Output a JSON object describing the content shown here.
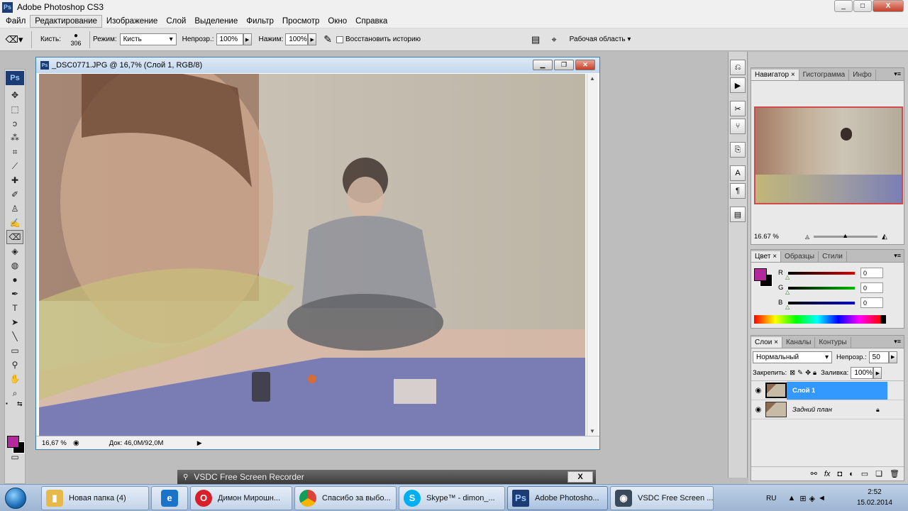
{
  "window": {
    "title": "Adobe Photoshop CS3",
    "min": "_",
    "max": "□",
    "close": "X"
  },
  "menu": [
    "Файл",
    "Редактирование",
    "Изображение",
    "Слой",
    "Выделение",
    "Фильтр",
    "Просмотр",
    "Окно",
    "Справка"
  ],
  "options": {
    "brush_label": "Кисть:",
    "brush_size": "306",
    "mode_label": "Режим:",
    "mode_value": "Кисть",
    "opacity_label": "Непрозр.:",
    "opacity_value": "100%",
    "flow_label": "Нажим:",
    "flow_value": "100%",
    "restore_history": "Восстановить историю",
    "workspace": "Рабочая область ▾"
  },
  "document": {
    "title": "_DSC0771.JPG @ 16,7% (Слой 1, RGB/8)",
    "zoom": "16,67 %",
    "doc_size": "Док: 46,0M/92,0M"
  },
  "navigator": {
    "tabs": [
      "Навигатор",
      "Гистограмма",
      "Инфо"
    ],
    "zoom": "16.67 %"
  },
  "color_panel": {
    "tabs": [
      "Цвет",
      "Образцы",
      "Стили"
    ],
    "channels": [
      {
        "label": "R",
        "value": "0",
        "color": "#cc0000"
      },
      {
        "label": "G",
        "value": "0",
        "color": "#00aa00"
      },
      {
        "label": "B",
        "value": "0",
        "color": "#0000cc"
      }
    ],
    "foreground": "#b4289b",
    "background": "#000000"
  },
  "layers_panel": {
    "tabs": [
      "Слои",
      "Каналы",
      "Контуры"
    ],
    "blend_mode": "Нормальный",
    "opacity_label": "Непрозр.:",
    "opacity_value": "50",
    "lock_label": "Закрепить:",
    "fill_label": "Заливка:",
    "fill_value": "100%",
    "layers": [
      {
        "name": "Слой 1",
        "selected": true
      },
      {
        "name": "Задний план",
        "selected": false
      }
    ]
  },
  "recorder": {
    "title": "VSDC Free Screen Recorder",
    "close": "X"
  },
  "taskbar": {
    "items": [
      {
        "label": "Новая папка (4)",
        "icon_color": "#e6b94a"
      },
      {
        "label": "",
        "icon_color": "#1a73c9"
      },
      {
        "label": "Димон Мирошн...",
        "icon_color": "#d8202a"
      },
      {
        "label": "Спасибо за выбо...",
        "icon_color": "#db4437"
      },
      {
        "label": "Skype™ - dimon_...",
        "icon_color": "#00aff0"
      },
      {
        "label": "Adobe Photosho...",
        "icon_color": "#1d3c74"
      },
      {
        "label": "VSDC Free Screen ...",
        "icon_color": "#3a4a5a"
      }
    ],
    "lang": "RU",
    "time": "2:52",
    "date": "15.02.2014"
  }
}
